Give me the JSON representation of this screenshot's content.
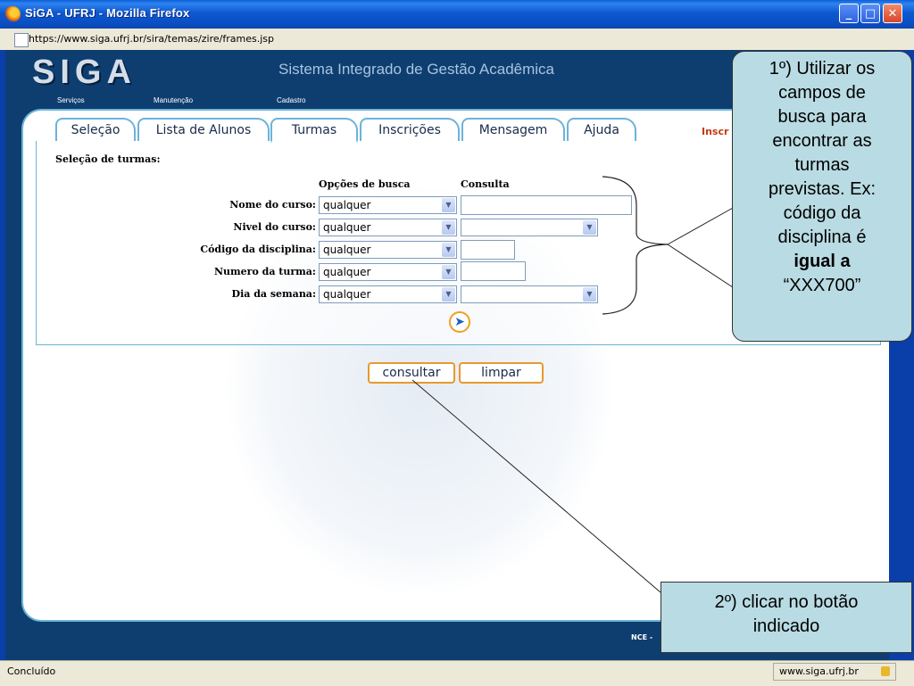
{
  "window": {
    "title": "SiGA - UFRJ - Mozilla Firefox",
    "url": "https://www.siga.ufrj.br/sira/temas/zire/frames.jsp",
    "controls": {
      "minimize": "_",
      "maximize": "□",
      "close": "✕"
    }
  },
  "header": {
    "logo": "SIGA",
    "system_title": "Sistema Integrado de Gestão Acadêmica",
    "menu": [
      "Serviços",
      "Manutenção",
      "Cadastro"
    ]
  },
  "tabs": [
    "Seleção",
    "Lista de Alunos",
    "Turmas",
    "Inscrições",
    "Mensagem",
    "Ajuda"
  ],
  "active_tab": "Turmas",
  "tab_right_label": "Inscr",
  "form": {
    "title": "Seleção de turmas:",
    "col_options": "Opções de busca",
    "col_query": "Consulta",
    "fields": [
      {
        "label": "Nome do curso:",
        "option": "qualquer"
      },
      {
        "label": "Nivel do curso:",
        "option": "qualquer"
      },
      {
        "label": "Código da disciplina:",
        "option": "qualquer"
      },
      {
        "label": "Numero da turma:",
        "option": "qualquer"
      },
      {
        "label": "Dia da semana:",
        "option": "qualquer"
      }
    ],
    "buttons": {
      "consultar": "consultar",
      "limpar": "limpar"
    }
  },
  "footer": {
    "nce": "NCE -"
  },
  "status": {
    "text": "Concluído",
    "host": "www.siga.ufrj.br"
  },
  "callouts": {
    "first": {
      "lines": [
        "1º) Utilizar os",
        "campos de",
        "busca para",
        "encontrar as",
        "turmas",
        "previstas. Ex:",
        "código da",
        "disciplina é"
      ],
      "bold": "igual a",
      "last": "“XXX700”"
    },
    "second": {
      "lines": [
        "2º) clicar no botão",
        "indicado"
      ]
    }
  },
  "colors": {
    "accent": "#6bb3d9",
    "button_border": "#e79a2e",
    "callout_bg": "#b9dbe3",
    "header_bg": "#0e3e70"
  }
}
